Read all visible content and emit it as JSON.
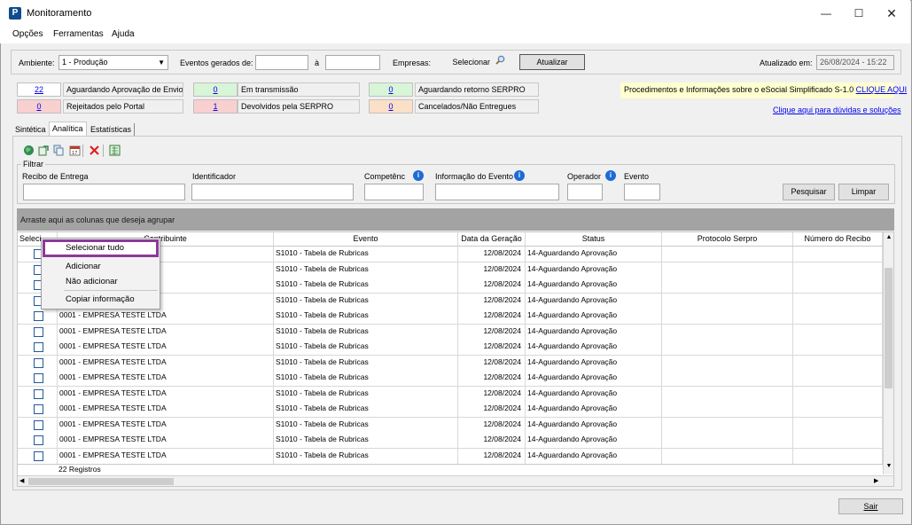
{
  "window": {
    "title": "Monitoramento",
    "app_letter": "P"
  },
  "menu": [
    "Opções",
    "Ferramentas",
    "Ajuda"
  ],
  "filters": {
    "ambiente_label": "Ambiente:",
    "ambiente_value": "1 - Produção",
    "eventos_label": "Eventos gerados de:",
    "date_from": "",
    "a_label": "à",
    "date_to": "",
    "empresas_label": "Empresas:",
    "selecionar_label": "Selecionar",
    "atualizar_label": "Atualizar",
    "atualizado_label": "Atualizado em:",
    "atualizado_value": "26/08/2024 - 15:22"
  },
  "status": {
    "aguardando_aprovacao": {
      "count": "22",
      "label": "Aguardando Aprovação de Envio"
    },
    "rejeitados": {
      "count": "0",
      "label": "Rejeitados pelo Portal"
    },
    "em_transmissao": {
      "count": "0",
      "label": "Em transmissão"
    },
    "devolvidos": {
      "count": "1",
      "label": "Devolvidos pela SERPRO"
    },
    "aguardando_retorno": {
      "count": "0",
      "label": "Aguardando retorno SERPRO"
    },
    "cancelados": {
      "count": "0",
      "label": "Cancelados/Não Entregues"
    }
  },
  "info": {
    "text": "Procedimentos e Informações sobre o eSocial Simplificado S-1.0",
    "link": "CLIQUE AQUI",
    "help_link": "Clique aqui para dúvidas e soluções"
  },
  "tabs": [
    "Sintética",
    "Analítica",
    "Estatísticas"
  ],
  "filter_panel": {
    "title": "Filtrar",
    "recibo": "Recibo de Entrega",
    "identificador": "Identificador",
    "competencia": "Competênc",
    "informacao": "Informação do Evento",
    "operador": "Operador",
    "evento": "Evento",
    "pesquisar": "Pesquisar",
    "limpar": "Limpar"
  },
  "grid": {
    "group_hint": "Arraste aqui as colunas que deseja agrupar",
    "columns": [
      "Seleci",
      "Contribuinte",
      "Evento",
      "Data da Geração",
      "Status",
      "Protocolo Serpro",
      "Número do Recibo"
    ],
    "rows": [
      {
        "contribuinte": "",
        "evento": "S1010 - Tabela de Rubricas",
        "data": "12/08/2024",
        "status": "14-Aguardando Aprovação"
      },
      {
        "contribuinte": "",
        "evento": "S1010 - Tabela de Rubricas",
        "data": "12/08/2024",
        "status": "14-Aguardando Aprovação"
      },
      {
        "contribuinte": "",
        "evento": "S1010 - Tabela de Rubricas",
        "data": "12/08/2024",
        "status": "14-Aguardando Aprovação"
      },
      {
        "contribuinte": "",
        "evento": "S1010 - Tabela de Rubricas",
        "data": "12/08/2024",
        "status": "14-Aguardando Aprovação"
      },
      {
        "contribuinte": "0001 - EMPRESA TESTE LTDA",
        "evento": "S1010 - Tabela de Rubricas",
        "data": "12/08/2024",
        "status": "14-Aguardando Aprovação"
      },
      {
        "contribuinte": "0001 - EMPRESA TESTE LTDA",
        "evento": "S1010 - Tabela de Rubricas",
        "data": "12/08/2024",
        "status": "14-Aguardando Aprovação"
      },
      {
        "contribuinte": "0001 - EMPRESA TESTE LTDA",
        "evento": "S1010 - Tabela de Rubricas",
        "data": "12/08/2024",
        "status": "14-Aguardando Aprovação"
      },
      {
        "contribuinte": "0001 - EMPRESA TESTE LTDA",
        "evento": "S1010 - Tabela de Rubricas",
        "data": "12/08/2024",
        "status": "14-Aguardando Aprovação"
      },
      {
        "contribuinte": "0001 - EMPRESA TESTE LTDA",
        "evento": "S1010 - Tabela de Rubricas",
        "data": "12/08/2024",
        "status": "14-Aguardando Aprovação"
      },
      {
        "contribuinte": "0001 - EMPRESA TESTE LTDA",
        "evento": "S1010 - Tabela de Rubricas",
        "data": "12/08/2024",
        "status": "14-Aguardando Aprovação"
      },
      {
        "contribuinte": "0001 - EMPRESA TESTE LTDA",
        "evento": "S1010 - Tabela de Rubricas",
        "data": "12/08/2024",
        "status": "14-Aguardando Aprovação"
      },
      {
        "contribuinte": "0001 - EMPRESA TESTE LTDA",
        "evento": "S1010 - Tabela de Rubricas",
        "data": "12/08/2024",
        "status": "14-Aguardando Aprovação"
      },
      {
        "contribuinte": "0001 - EMPRESA TESTE LTDA",
        "evento": "S1010 - Tabela de Rubricas",
        "data": "12/08/2024",
        "status": "14-Aguardando Aprovação"
      },
      {
        "contribuinte": "0001 - EMPRESA TESTE LTDA",
        "evento": "S1010 - Tabela de Rubricas",
        "data": "12/08/2024",
        "status": "14-Aguardando Aprovação"
      }
    ],
    "footer": "22 Registros"
  },
  "context_menu": [
    "Selecionar tudo",
    "Adicionar",
    "Não adicionar",
    "Copiar informação"
  ],
  "sair_label": "Sair",
  "colors": {
    "accent_blue": "#0000ee",
    "menu_highlight": "#8b3a9a"
  }
}
